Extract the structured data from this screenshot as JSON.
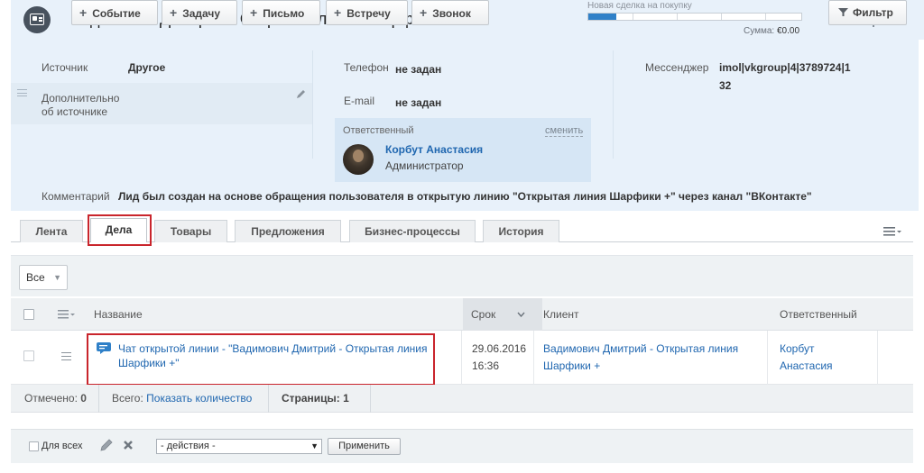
{
  "header": {
    "title": "Вадимович Дмитрий - Открытая линия Шарфики +",
    "icon": "contact-card-icon",
    "deal": {
      "label": "Новая сделка на покупку",
      "progress": 0.13,
      "sum_label": "Сумма:",
      "sum_value": "€0.00"
    }
  },
  "info": {
    "source_label": "Источник",
    "source_value": "Другое",
    "additional_label_1": "Дополнительно",
    "additional_label_2": "об источнике",
    "phone_label": "Телефон",
    "phone_value": "не задан",
    "email_label": "E-mail",
    "email_value": "не задан",
    "responsible_label": "Ответственный",
    "change_link": "сменить",
    "responsible_name": "Корбут Анастасия",
    "responsible_role": "Администратор",
    "messenger_label": "Мессенджер",
    "messenger_value_1": "imol|vkgroup|4|3789724|1",
    "messenger_value_2": "32",
    "comment_label": "Комментарий",
    "comment_value": "Лид был создан на основе обращения пользователя в открытую линию \"Открытая линия Шарфики +\" через канал \"ВКонтакте\""
  },
  "tabs": [
    "Лента",
    "Дела",
    "Товары",
    "Предложения",
    "Бизнес-процессы",
    "История"
  ],
  "active_tab": "Дела",
  "toolbar": {
    "select_all": "Все",
    "buttons": [
      "Событие",
      "Задачу",
      "Письмо",
      "Встречу",
      "Звонок"
    ],
    "filter": "Фильтр"
  },
  "grid": {
    "columns": [
      "Название",
      "Срок",
      "Клиент",
      "Ответственный"
    ],
    "rows": [
      {
        "title_1": "Чат открытой линии - \"Вадимович Дмитрий - Открытая линия",
        "title_2": "Шарфики +\"",
        "date": "29.06.2016",
        "time": "16:36",
        "client_1": "Вадимович Дмитрий - Открытая линия",
        "client_2": "Шарфики +",
        "responsible_1": "Корбут",
        "responsible_2": "Анастасия"
      }
    ],
    "footer": {
      "checked_label": "Отмечено:",
      "checked_value": "0",
      "total_label": "Всего:",
      "total_link": "Показать количество",
      "pages_label": "Страницы:",
      "pages_value": "1"
    }
  },
  "actions": {
    "for_all": "Для всех",
    "select_value": "- действия -",
    "apply": "Применить"
  },
  "colors": {
    "panel_bg": "#e8f1fa",
    "link": "#2067b0",
    "highlight": "#c9252c",
    "progress": "#2f80c8"
  }
}
